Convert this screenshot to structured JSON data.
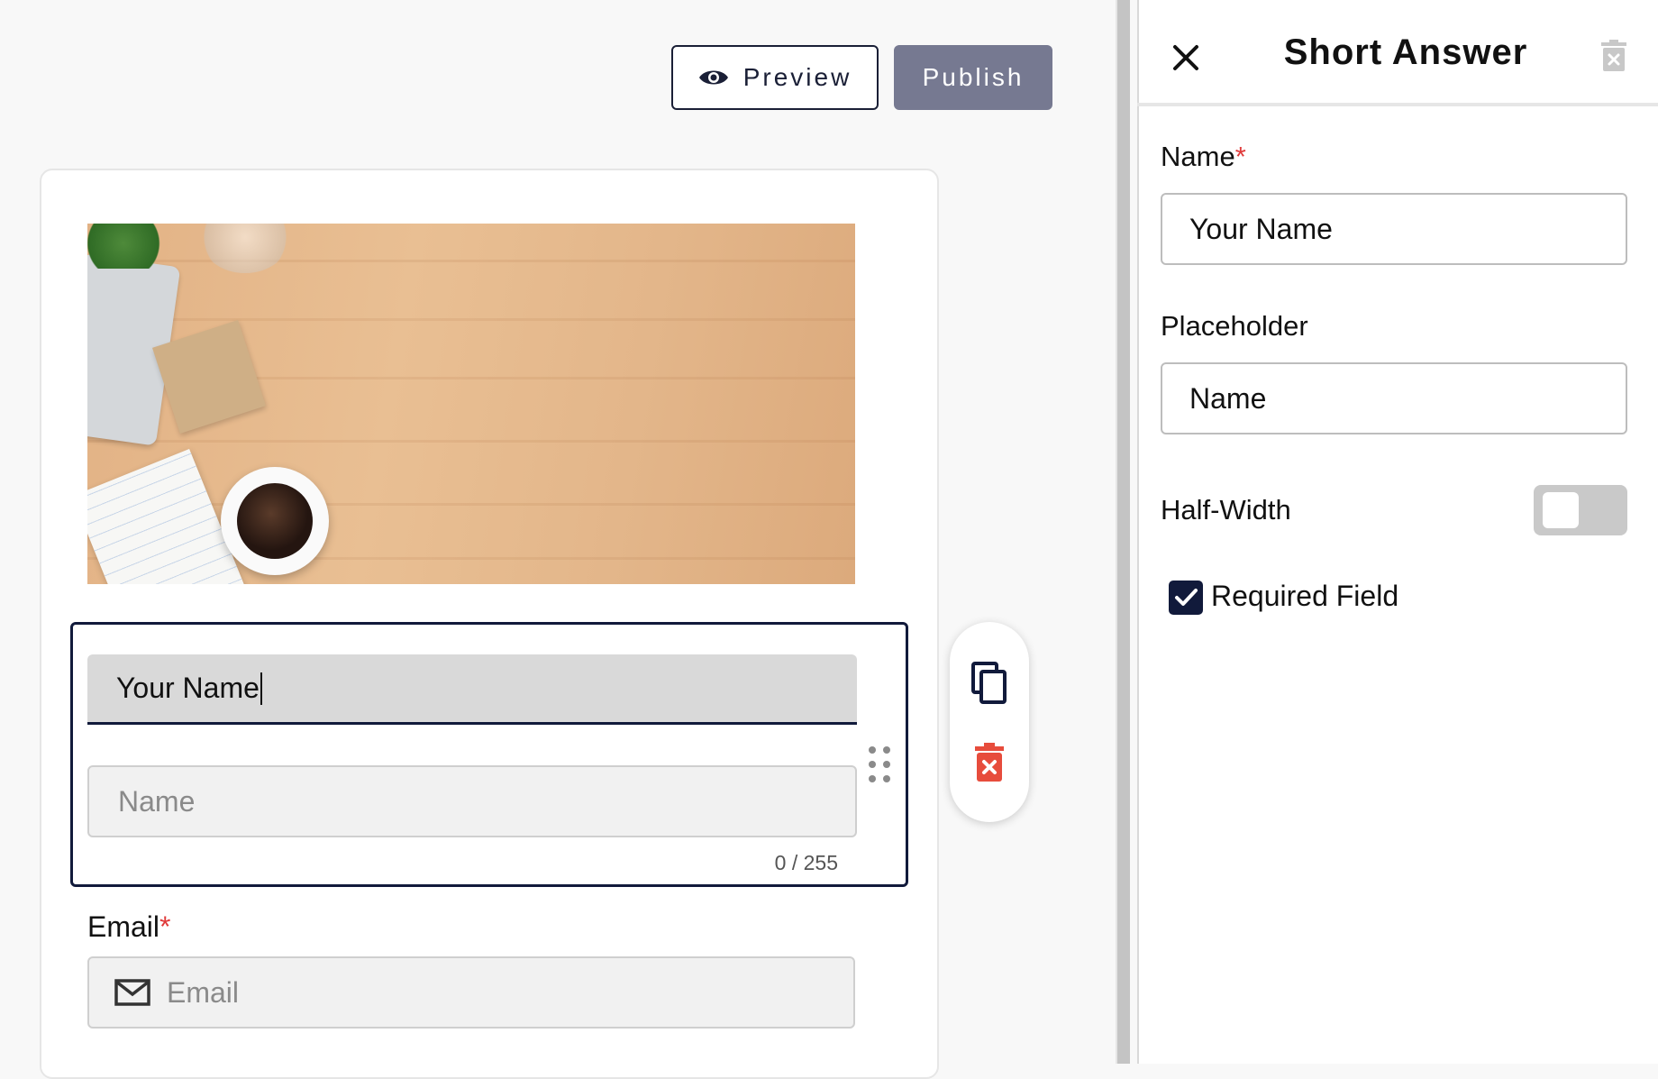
{
  "toolbar": {
    "preview_label": "Preview",
    "publish_label": "Publish"
  },
  "form": {
    "field": {
      "label_value": "Your Name",
      "placeholder": "Name",
      "counter": "0 / 255"
    },
    "email": {
      "label": "Email",
      "required_mark": "*",
      "placeholder": "Email"
    }
  },
  "panel": {
    "title": "Short Answer",
    "name_label": "Name",
    "name_required_mark": "*",
    "name_value": "Your Name",
    "placeholder_label": "Placeholder",
    "placeholder_value": "Name",
    "half_width_label": "Half-Width",
    "half_width_on": false,
    "required_label": "Required Field",
    "required_checked": true
  },
  "icons": {
    "preview": "eye-icon",
    "copy": "copy-icon",
    "delete": "trash-icon",
    "close": "close-icon",
    "email": "mail-icon",
    "drag": "drag-handle-icon"
  },
  "colors": {
    "accent": "#111a3b",
    "publish_bg": "#767991",
    "required": "#e03b3b",
    "delete_red": "#e74c3c"
  }
}
